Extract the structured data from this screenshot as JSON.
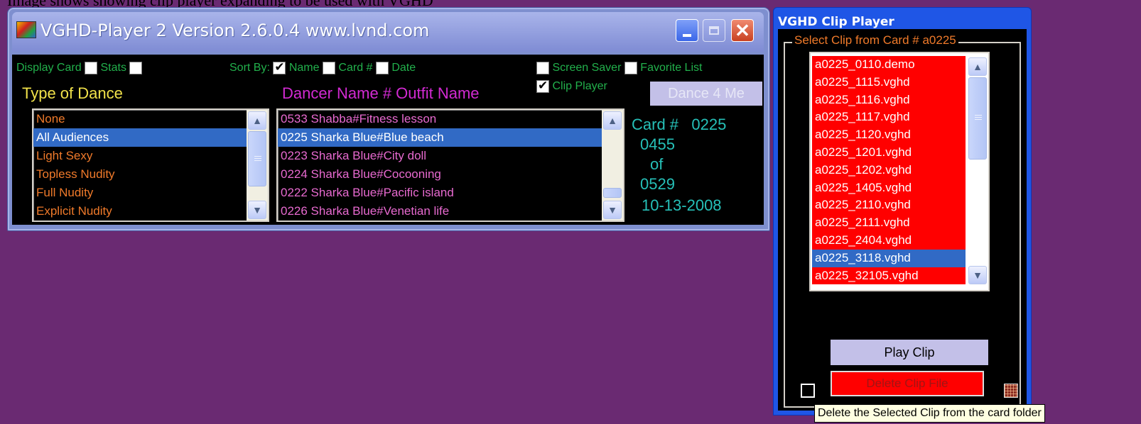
{
  "header_text": "Image shows showing clip player expanding to be used with VGHD",
  "main_window": {
    "title": "VGHD-Player 2  Version 2.6.0.4  www.lvnd.com",
    "display_card_label": "Display Card",
    "display_card_checked": false,
    "stats_label": "Stats",
    "stats_checked": false,
    "sort_by_label": "Sort By:",
    "sort_name_label": "Name",
    "sort_name_checked": true,
    "sort_card_label": "Card #",
    "sort_card_checked": false,
    "sort_date_label": "Date",
    "sort_date_checked": false,
    "screen_saver_label": "Screen Saver",
    "screen_saver_checked": false,
    "favorite_list_label": "Favorite List",
    "favorite_list_checked": false,
    "clip_player_label": "Clip Player",
    "clip_player_checked": true,
    "dance_button_label": "Dance 4 Me",
    "type_of_dance_header": "Type of Dance",
    "dancer_header": "Dancer Name # Outfit Name",
    "dance_types": [
      {
        "label": "None",
        "selected": false
      },
      {
        "label": "All Audiences",
        "selected": true
      },
      {
        "label": "Light Sexy",
        "selected": false
      },
      {
        "label": "Topless Nudity",
        "selected": false
      },
      {
        "label": "Full Nudity",
        "selected": false
      },
      {
        "label": "Explicit Nudity",
        "selected": false
      }
    ],
    "dancers": [
      {
        "label": "0533 Shabba#Fitness lesson",
        "selected": false
      },
      {
        "label": "0225 Sharka Blue#Blue beach",
        "selected": true
      },
      {
        "label": "0223 Sharka Blue#City doll",
        "selected": false
      },
      {
        "label": "0224 Sharka Blue#Cocooning",
        "selected": false
      },
      {
        "label": "0222 Sharka Blue#Pacific island",
        "selected": false
      },
      {
        "label": "0226 Sharka Blue#Venetian life",
        "selected": false
      }
    ],
    "card_info": {
      "card_label": "Card #",
      "card_number": "0225",
      "position": "0455",
      "of_label": "of",
      "total": "0529",
      "date": "10-13-2008"
    },
    "colors": {
      "selected_bg": "#316ac5",
      "dance_type_text": "#f07a2a",
      "dancer_text": "#e86ad0",
      "accent_green": "#22b14c"
    }
  },
  "clip_window": {
    "title": "VGHD Clip Player",
    "group_label": "Select Clip from Card # a0225",
    "clips": [
      {
        "label": "a0225_0110.demo",
        "selected": false
      },
      {
        "label": "a0225_1115.vghd",
        "selected": false
      },
      {
        "label": "a0225_1116.vghd",
        "selected": false
      },
      {
        "label": "a0225_1117.vghd",
        "selected": false
      },
      {
        "label": "a0225_1120.vghd",
        "selected": false
      },
      {
        "label": "a0225_1201.vghd",
        "selected": false
      },
      {
        "label": "a0225_1202.vghd",
        "selected": false
      },
      {
        "label": "a0225_1405.vghd",
        "selected": false
      },
      {
        "label": "a0225_2110.vghd",
        "selected": false
      },
      {
        "label": "a0225_2111.vghd",
        "selected": false
      },
      {
        "label": "a0225_2404.vghd",
        "selected": false
      },
      {
        "label": "a0225_3118.vghd",
        "selected": true
      },
      {
        "label": "a0225_32105.vghd",
        "selected": false
      }
    ],
    "play_button_label": "Play Clip",
    "delete_button_label": "Delete Clip File",
    "option_checked": false
  },
  "tooltip": "Delete the Selected Clip from the card folder"
}
